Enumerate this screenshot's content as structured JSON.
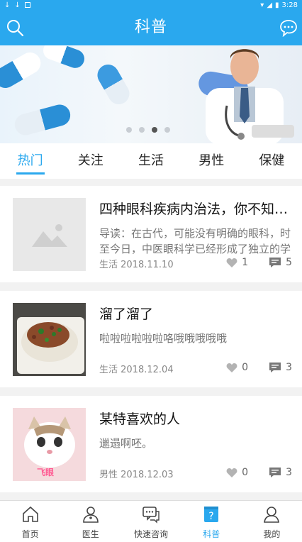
{
  "status_bar": {
    "time": "3:28"
  },
  "header": {
    "title": "科普",
    "left_icon": "search-icon",
    "right_icon": "chat-bubble-icon"
  },
  "banner": {
    "slides": 4,
    "active_slide": 3
  },
  "tabs": [
    {
      "label": "热门",
      "active": true
    },
    {
      "label": "关注",
      "active": false
    },
    {
      "label": "生活",
      "active": false
    },
    {
      "label": "男性",
      "active": false
    },
    {
      "label": "保健",
      "active": false
    }
  ],
  "articles": [
    {
      "title": "四种眼科疾病内治法，你不知道的",
      "desc": "导读：在古代，可能没有明确的眼科，时至今日，中医眼科学已经形成了独立的学科体系",
      "category": "生活",
      "date": "2018.11.10",
      "likes": "1",
      "comments": "5",
      "thumb": "placeholder-image-icon"
    },
    {
      "title": "溜了溜了",
      "desc": "啦啦啦啦啦啦咯哦哦哦哦哦",
      "category": "生活",
      "date": "2018.12.04",
      "likes": "0",
      "comments": "3",
      "thumb": "food-photo"
    },
    {
      "title": "某特喜欢的人",
      "desc": "邋遢啊呸。",
      "category": "男性",
      "date": "2018.12.03",
      "likes": "0",
      "comments": "3",
      "thumb": "cat-photo",
      "thumb_text": "飞眼"
    }
  ],
  "bottom_nav": [
    {
      "label": "首页",
      "icon": "home-icon",
      "active": false
    },
    {
      "label": "医生",
      "icon": "doctor-icon",
      "active": false
    },
    {
      "label": "快速咨询",
      "icon": "consult-icon",
      "active": false
    },
    {
      "label": "科普",
      "icon": "science-icon",
      "active": true
    },
    {
      "label": "我的",
      "icon": "profile-icon",
      "active": false
    }
  ],
  "colors": {
    "brand": "#2aa8ee",
    "text": "#222222",
    "muted": "#888888"
  }
}
